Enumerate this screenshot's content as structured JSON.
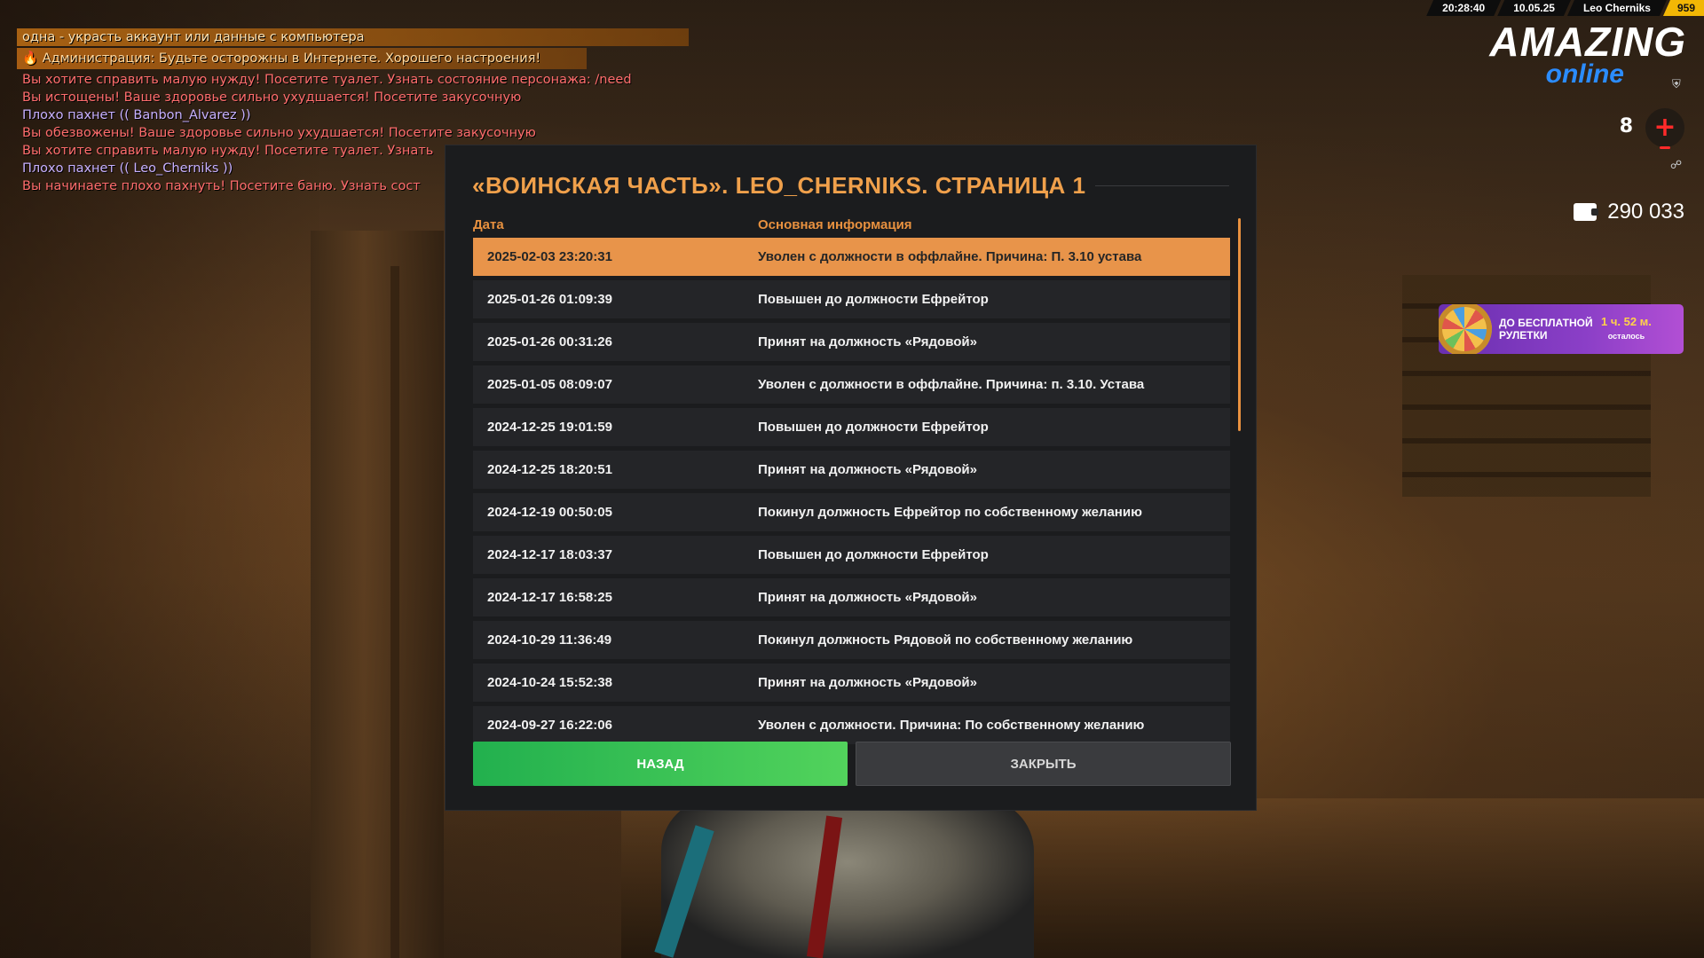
{
  "status_bar": {
    "time": "20:28:40",
    "date": "10.05.25",
    "player": "Leo Cherniks",
    "id": "959"
  },
  "logo": {
    "main": "AMAZING",
    "sub": "online"
  },
  "hud": {
    "hp_value": "8",
    "hp_icon": "+",
    "money": "290 033",
    "accent_color": "#e8913f"
  },
  "roulette": {
    "label": "ДО БЕСПЛАТНОЙ РУЛЕТКИ",
    "time": "1 ч. 52 м.",
    "time_suffix": "осталось"
  },
  "chat": [
    {
      "text": "одна - украсть аккаунт или данные с компьютера",
      "style": "hl"
    },
    {
      "text": "🔥 Администрация: Будьте осторожны в Интернете. Хорошего настроения!",
      "style": "admin"
    },
    {
      "text": "Вы хотите справить малую нужду! Посетите туалет. Узнать состояние персонажа: /need",
      "style": "red"
    },
    {
      "text": "Вы истощены! Ваше здоровье сильно ухудшается! Посетите закусочную",
      "style": "red"
    },
    {
      "text": "Плохо пахнет (( Banbon_Alvarez ))",
      "style": "purple"
    },
    {
      "text": "Вы обезвожены! Ваше здоровье сильно ухудшается! Посетите закусочную",
      "style": "red"
    },
    {
      "text": "Вы хотите справить малую нужду! Посетите туалет. Узнать",
      "style": "red"
    },
    {
      "text": "Плохо пахнет (( Leo_Cherniks ))",
      "style": "purple"
    },
    {
      "text": "Вы начинаете плохо пахнуть! Посетите баню. Узнать сост",
      "style": "red"
    }
  ],
  "dialog": {
    "title": "«ВОИНСКАЯ ЧАСТЬ». LEO_CHERNIKS. СТРАНИЦА 1",
    "col_date": "Дата",
    "col_info": "Основная информация",
    "rows": [
      {
        "date": "2025-02-03 23:20:31",
        "info": "Уволен с должности в оффлайне. Причина: П. 3.10 устава",
        "selected": true
      },
      {
        "date": "2025-01-26 01:09:39",
        "info": "Повышен до должности Ефрейтор"
      },
      {
        "date": "2025-01-26 00:31:26",
        "info": "Принят на должность «Рядовой»"
      },
      {
        "date": "2025-01-05 08:09:07",
        "info": "Уволен с должности в оффлайне. Причина: п. 3.10. Устава"
      },
      {
        "date": "2024-12-25 19:01:59",
        "info": "Повышен до должности Ефрейтор"
      },
      {
        "date": "2024-12-25 18:20:51",
        "info": "Принят на должность «Рядовой»"
      },
      {
        "date": "2024-12-19 00:50:05",
        "info": "Покинул должность Ефрейтор по собственному желанию"
      },
      {
        "date": "2024-12-17 18:03:37",
        "info": "Повышен до должности Ефрейтор"
      },
      {
        "date": "2024-12-17 16:58:25",
        "info": "Принят на должность «Рядовой»"
      },
      {
        "date": "2024-10-29 11:36:49",
        "info": "Покинул должность Рядовой по собственному желанию"
      },
      {
        "date": "2024-10-24 15:52:38",
        "info": "Принят на должность «Рядовой»"
      },
      {
        "date": "2024-09-27 16:22:06",
        "info": "Уволен с должности. Причина: По собственному желанию"
      }
    ],
    "back_label": "НАЗАД",
    "close_label": "ЗАКРЫТЬ"
  }
}
